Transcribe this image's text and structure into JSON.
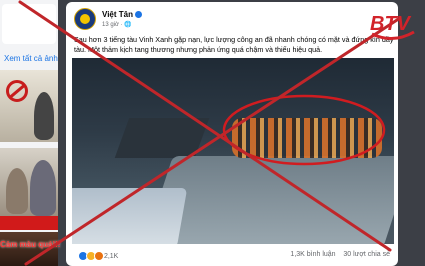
{
  "left_panel": {
    "see_all_label": "Xem tất cả ảnh",
    "overlay_text": "Cảm màu quá!!!"
  },
  "post": {
    "author": "Việt Tân",
    "time": "13 giờ",
    "caption": "Sau hơn 3 tiếng tàu Vinh Xanh gặp nạn, lực lượng công an đã nhanh chóng có mặt và đứng kín đầy tàu. Một thảm kịch tang thương nhưng phản ứng quá chậm và thiếu hiệu quả.",
    "reactions_count": "2,1K",
    "comments_count": "1,3K bình luận",
    "shares_count": "30 lượt chia sẻ"
  },
  "logo": {
    "text": "BTV"
  },
  "colors": {
    "cross": "#c0262a",
    "fb_blue": "#1b74e4",
    "logo_red": "#d2232a",
    "logo_green": "#1a9a46"
  }
}
